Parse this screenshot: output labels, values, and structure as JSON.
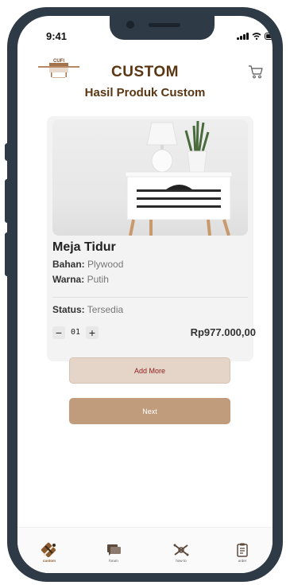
{
  "status_bar": {
    "time": "9:41"
  },
  "header": {
    "logo_text": "CUFI",
    "title": "CUSTOM",
    "subtitle": "Hasil Produk Custom"
  },
  "product": {
    "name": "Meja Tidur",
    "material_label": "Bahan:",
    "material_value": "Plywood",
    "color_label": "Warna:",
    "color_value": "Putih",
    "status_label": "Status:",
    "status_value": "Tersedia",
    "quantity": "01",
    "price": "Rp977.000,00"
  },
  "actions": {
    "add_more_label": "Add More",
    "next_label": "Next"
  },
  "nav": {
    "items": [
      {
        "label": "custom",
        "icon": "custom-tools-icon",
        "active": true
      },
      {
        "label": "forum",
        "icon": "forum-icon",
        "active": false
      },
      {
        "label": "how to",
        "icon": "how-to-icon",
        "active": false
      },
      {
        "label": "order",
        "icon": "order-icon",
        "active": false
      }
    ]
  },
  "colors": {
    "brand_brown": "#5a3612",
    "add_more_bg": "#e4d5c8",
    "add_more_text": "#8c1d1d",
    "next_bg": "#c19c7c",
    "frame": "#2e3a45"
  }
}
